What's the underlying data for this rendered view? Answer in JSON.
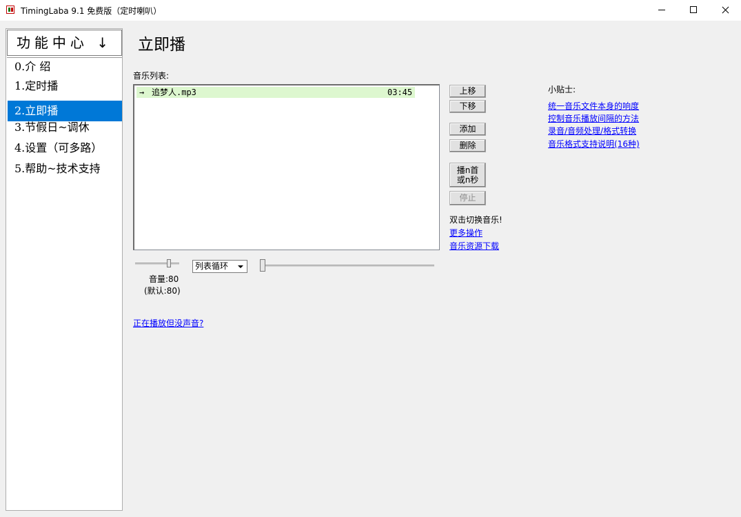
{
  "window": {
    "title": "TimingLaba 9.1 免费版（定时喇叭）",
    "buttons": {
      "minimize": "minimize",
      "maximize": "maximize",
      "close": "close"
    }
  },
  "sidebar": {
    "header": "功能中心 ↓",
    "items": [
      {
        "label": "0.介 绍",
        "selected": false
      },
      {
        "label": "1.定时播",
        "selected": false
      },
      {
        "label": "2.立即播",
        "selected": true
      },
      {
        "label": "3.节假日~调休",
        "selected": false
      },
      {
        "label": "4.设置（可多路）",
        "selected": false
      },
      {
        "label": "5.帮助~技术支持",
        "selected": false
      }
    ]
  },
  "main": {
    "title": "立即播",
    "list_label": "音乐列表:",
    "tracks": [
      {
        "arrow": "→",
        "name": "追梦人.mp3",
        "duration": "03:45"
      }
    ],
    "buttons": {
      "move_up": "上移",
      "move_down": "下移",
      "add": "添加",
      "delete": "删除",
      "play_line1": "播n首",
      "play_line2": "或n秒",
      "stop": "停止"
    },
    "hint_dblclick": "双击切换音乐!",
    "links": {
      "more": "更多操作",
      "download": "音乐资源下载",
      "no_sound": "正在播放但没声音?"
    },
    "volume": {
      "label": "音量:80",
      "default": "(默认:80)",
      "value": 80
    },
    "play_mode": {
      "selected": "列表循环"
    },
    "progress": {
      "value": 0
    }
  },
  "tips": {
    "label": "小贴士:",
    "links": [
      "统一音乐文件本身的响度",
      "控制音乐播放间隔的方法",
      "录音/音频处理/格式转换",
      "音乐格式支持说明(16种)"
    ]
  }
}
